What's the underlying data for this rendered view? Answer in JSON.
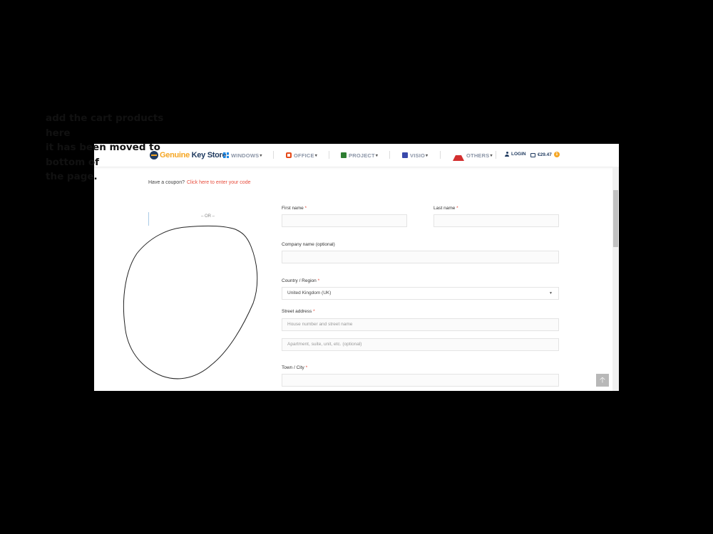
{
  "brand": {
    "part1": "Genuine",
    "part2": " Key Store"
  },
  "nav": {
    "windows": "WINDOWS",
    "office": "OFFICE",
    "project": "PROJECT",
    "visio": "VISIO",
    "others": "OTHERS",
    "login": "LOGIN",
    "cart_total": "€29.47",
    "cart_count": "1"
  },
  "coupon": {
    "prompt": "Have a coupon?",
    "link": "Click here to enter your code"
  },
  "or_text": "– OR –",
  "form": {
    "first_name_label": "First name",
    "last_name_label": "Last name",
    "company_label": "Company name (optional)",
    "country_label": "Country / Region",
    "country_value": "United Kingdom (UK)",
    "street_label": "Street address",
    "street_placeholder": "House number and street name",
    "apartment_placeholder": "Apartment, suite, unit, etc. (optional)",
    "town_label": "Town / City",
    "required_mark": "*"
  },
  "annotation": {
    "line1": "add the cart products here",
    "line2": "it has been moved to",
    "line3": "bottom of",
    "line4": "the page."
  },
  "icons": [
    "logo-icon",
    "windows-icon",
    "office-icon",
    "project-icon",
    "visio-icon",
    "others-icon",
    "user-icon",
    "bag-icon",
    "chevron-down-icon",
    "arrow-up-icon"
  ],
  "colors": {
    "accent": "#e74c3c",
    "brand_orange": "#f5a623",
    "brand_navy": "#1f3a5f"
  }
}
